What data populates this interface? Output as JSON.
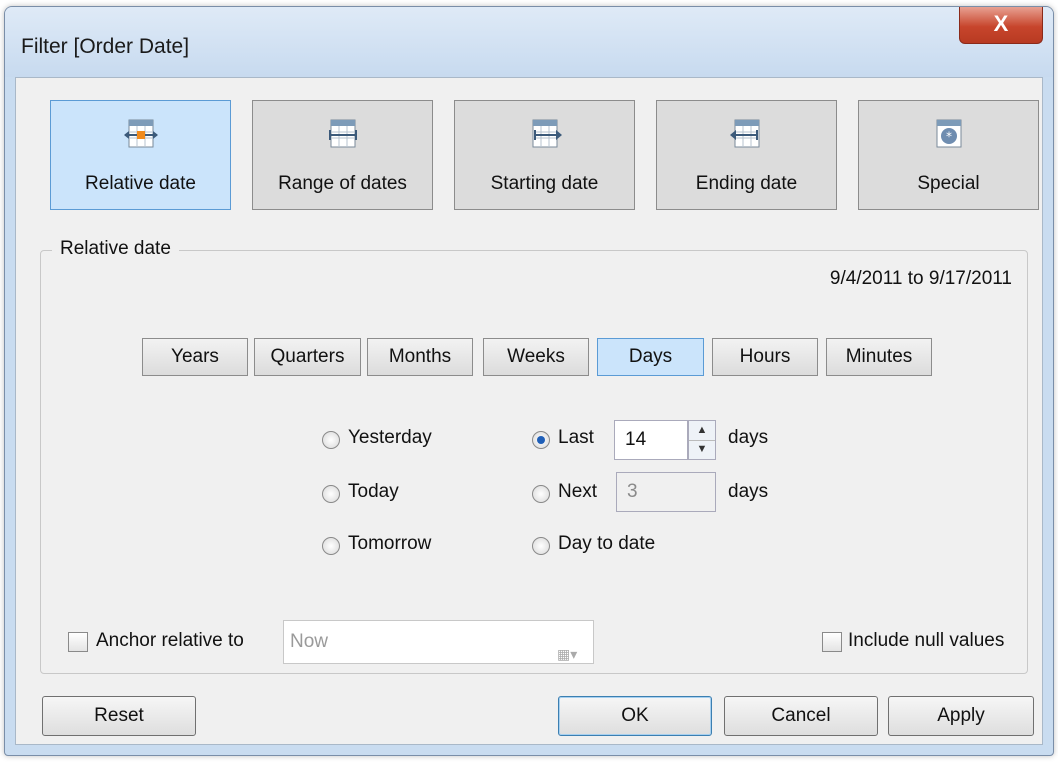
{
  "window": {
    "title": "Filter [Order Date]",
    "close_label": "X"
  },
  "filter_types": [
    {
      "label": "Relative date",
      "icon": "calendar-relative-icon",
      "selected": true
    },
    {
      "label": "Range of dates",
      "icon": "calendar-range-icon",
      "selected": false
    },
    {
      "label": "Starting date",
      "icon": "calendar-start-icon",
      "selected": false
    },
    {
      "label": "Ending date",
      "icon": "calendar-end-icon",
      "selected": false
    },
    {
      "label": "Special",
      "icon": "calendar-special-icon",
      "selected": false
    }
  ],
  "relative": {
    "group_title": "Relative date",
    "range_text": "9/4/2011 to 9/17/2011",
    "units": [
      "Years",
      "Quarters",
      "Months",
      "Weeks",
      "Days",
      "Hours",
      "Minutes"
    ],
    "selected_unit": "Days",
    "options": {
      "yesterday": "Yesterday",
      "today": "Today",
      "tomorrow": "Tomorrow",
      "last": "Last",
      "next": "Next",
      "to_date": "Day to date"
    },
    "selected_option": "Last",
    "last_value": "14",
    "next_value": "3",
    "unit_word": "days"
  },
  "anchor": {
    "label": "Anchor relative to",
    "value": "Now",
    "checked": false
  },
  "include_null": {
    "label": "Include null values",
    "checked": false
  },
  "buttons": {
    "reset": "Reset",
    "ok": "OK",
    "cancel": "Cancel",
    "apply": "Apply"
  },
  "colors": {
    "selected_bg": "#cbe4fb",
    "selected_border": "#5b9bd5",
    "close_red": "#c7452c"
  }
}
